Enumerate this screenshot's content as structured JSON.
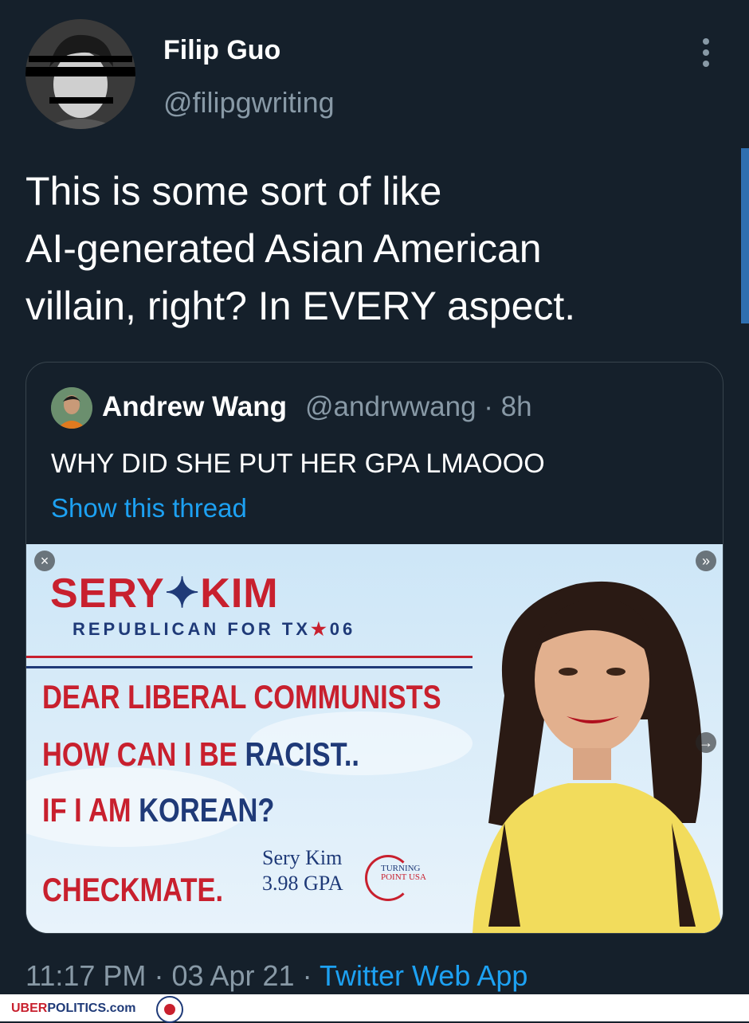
{
  "tweet": {
    "author_name": "Filip Guo",
    "author_handle": "@filipgwriting",
    "text_lines": [
      "This is some sort of like",
      "AI-generated Asian American",
      "villain, right? In EVERY aspect."
    ],
    "time": "11:17 PM",
    "date": "03 Apr 21",
    "separator": "·",
    "source": "Twitter Web App"
  },
  "quoted_tweet": {
    "author_name": "Andrew Wang",
    "author_handle": "@andrwwang",
    "age": "8h",
    "meta": "@andrwwang · 8h",
    "text": "WHY DID SHE PUT HER GPA LMAOOO",
    "thread_link": "Show this thread"
  },
  "ad_image": {
    "brand_left": "SERY",
    "brand_right": "KIM",
    "subtitle": "REPUBLICAN FOR TX",
    "district": "06",
    "line1": "DEAR LIBERAL COMMUNISTS",
    "line2_red": "HOW CAN I BE ",
    "line2_blue": "RACIST..",
    "line3_red": "IF I AM ",
    "line3_blue": "KOREAN?",
    "line4": "CHECKMATE.",
    "signature_name": "Sery Kim",
    "signature_gpa": "3.98 GPA",
    "tpusa_line1": "TURNING",
    "tpusa_line2": "POINT USA",
    "close_glyph": "×",
    "forward_glyph": "»",
    "arrow_glyph": "→"
  },
  "watermark": {
    "text_red": "UBER",
    "text_blue": "POLITICS.com"
  },
  "colors": {
    "background": "#15202b",
    "link": "#1da1f2",
    "muted": "#8899a6",
    "ad_red": "#c8202e",
    "ad_blue": "#1f3a78"
  }
}
